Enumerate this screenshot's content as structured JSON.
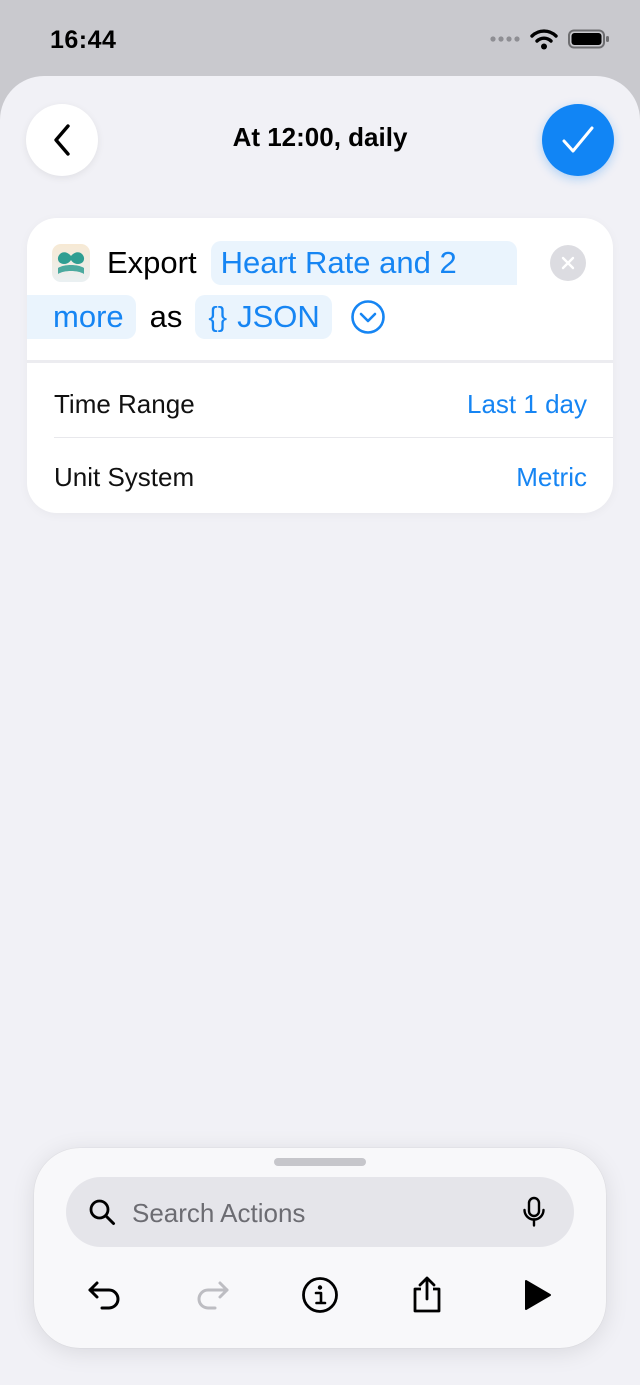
{
  "status_bar": {
    "time": "16:44"
  },
  "nav": {
    "title": "At 12:00, daily"
  },
  "action": {
    "verb": "Export",
    "data_token_line1": "Heart Rate and 2",
    "data_token_line2": "more",
    "connector": "as",
    "format_token_braces": "{}",
    "format_token_label": "JSON"
  },
  "parameters": [
    {
      "label": "Time Range",
      "value": "Last 1 day"
    },
    {
      "label": "Unit System",
      "value": "Metric"
    }
  ],
  "search": {
    "placeholder": "Search Actions"
  },
  "colors": {
    "accent": "#1685f3",
    "done_button": "#1185f5",
    "sheet_background": "#f1f1f6",
    "token_background": "#eaf4fd"
  },
  "icons": [
    "back-chevron-icon",
    "checkmark-icon",
    "health-app-icon",
    "clear-icon",
    "chevron-down-circle-icon",
    "search-icon",
    "microphone-icon",
    "undo-icon",
    "redo-icon",
    "info-icon",
    "share-icon",
    "play-icon"
  ]
}
